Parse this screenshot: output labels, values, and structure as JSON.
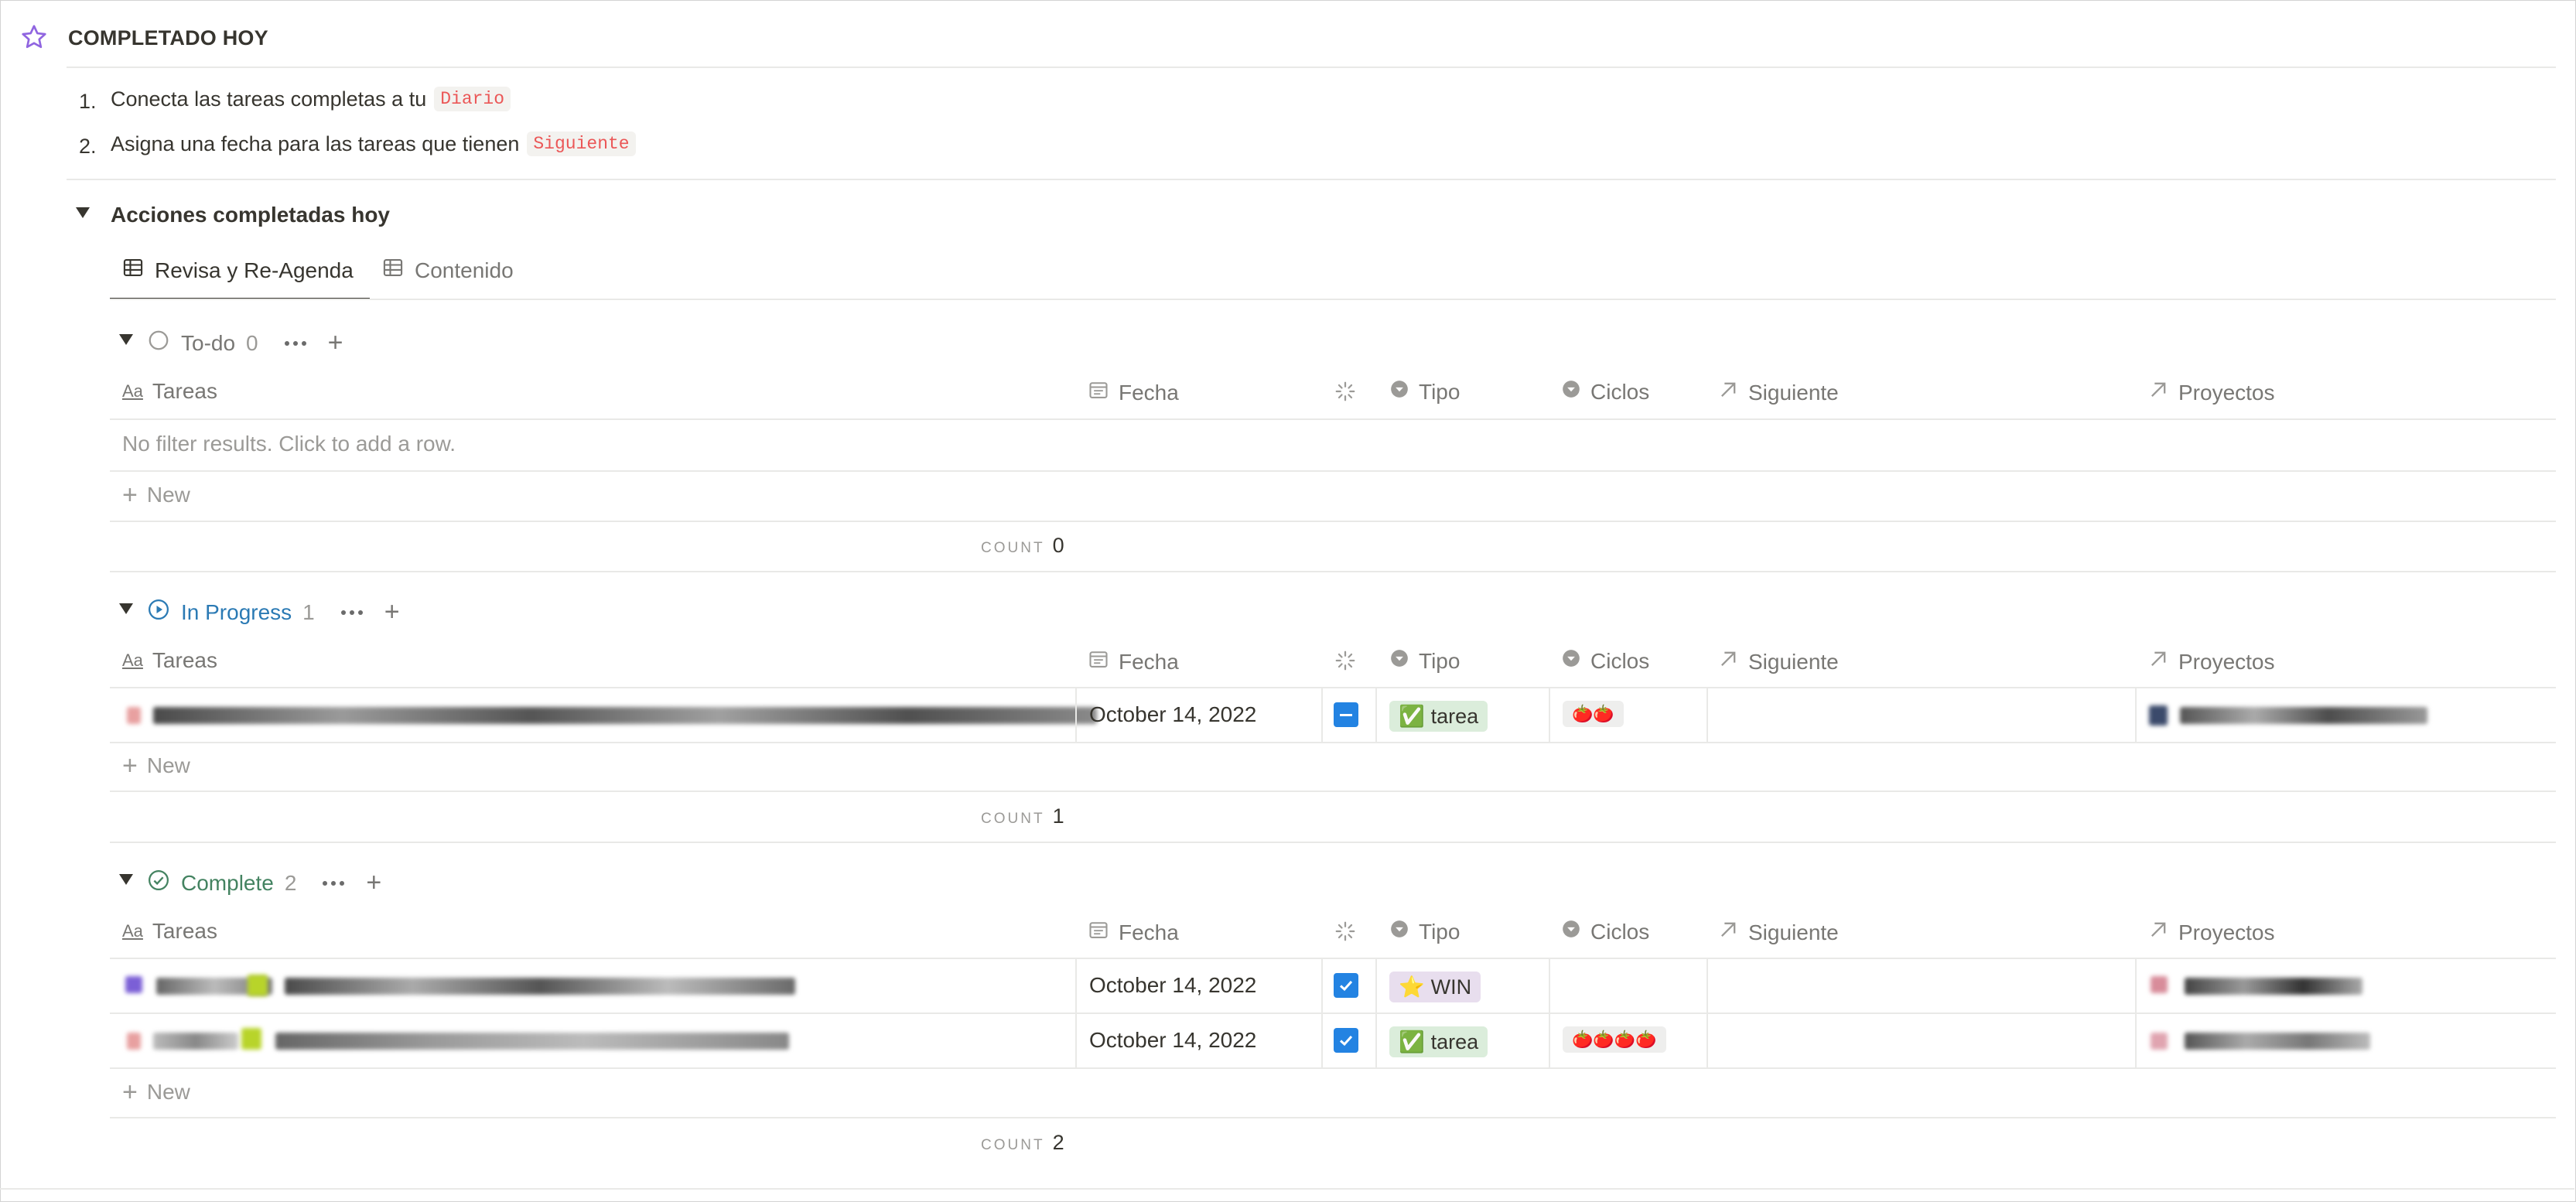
{
  "page": {
    "title": "COMPLETADO HOY",
    "list": [
      {
        "num": "1.",
        "text": "Conecta las tareas completas a tu",
        "code": "Diario"
      },
      {
        "num": "2.",
        "text": "Asigna una fecha para las tareas que tienen",
        "code": "Siguiente"
      }
    ]
  },
  "section": {
    "toggle_title": "Acciones completadas hoy",
    "tabs": [
      "Revisa y Re-Agenda",
      "Contenido"
    ]
  },
  "columns": {
    "tareas": "Tareas",
    "fecha": "Fecha",
    "tipo": "Tipo",
    "ciclos": "Ciclos",
    "siguiente": "Siguiente",
    "proyectos": "Proyectos"
  },
  "groups": {
    "todo": {
      "label": "To-do",
      "count": "0",
      "empty": "No filter results. Click to add a row.",
      "new": "New",
      "count_label": "COUNT",
      "count_value": "0"
    },
    "progress": {
      "label": "In Progress",
      "count": "1",
      "new": "New",
      "count_label": "COUNT",
      "count_value": "1",
      "rows": [
        {
          "fecha": "October 14, 2022",
          "tipo": "tarea",
          "tipo_icon": "✅",
          "ciclos": "🍅🍅"
        }
      ]
    },
    "complete": {
      "label": "Complete",
      "count": "2",
      "new": "New",
      "count_label": "COUNT",
      "count_value": "2",
      "rows": [
        {
          "fecha": "October 14, 2022",
          "tipo": "WIN",
          "tipo_icon": "⭐",
          "ciclos": ""
        },
        {
          "fecha": "October 14, 2022",
          "tipo": "tarea",
          "tipo_icon": "✅",
          "ciclos": "🍅🍅🍅🍅"
        }
      ]
    }
  },
  "colors": {
    "accent_purple": "#9065e0",
    "progress_blue": "#2b7ab4",
    "complete_green": "#448361",
    "checkbox_blue": "#2383e2",
    "code_red": "#eb5757"
  },
  "icons": {
    "star": "star-icon",
    "table": "table-icon",
    "calendar": "calendar-icon",
    "status": "status-icon",
    "select": "select-icon",
    "relation": "relation-arrow-icon"
  }
}
